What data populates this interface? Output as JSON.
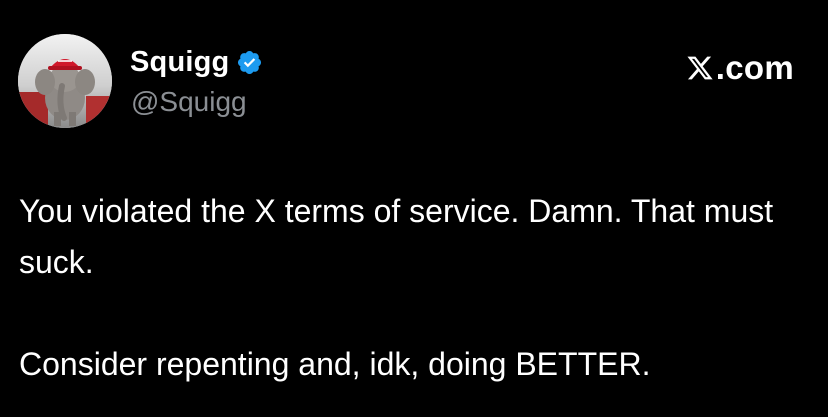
{
  "post": {
    "author": {
      "display_name": "Squigg",
      "handle": "@Squigg",
      "verified": true,
      "avatar": "elephant-in-red-cap"
    },
    "brand": {
      "text": ".com",
      "logo": "x-logo-icon"
    },
    "paragraphs": [
      "You violated the X terms of service. Damn. That must suck.",
      "Consider repenting and, idk, doing BETTER."
    ]
  },
  "colors": {
    "background": "#000000",
    "text": "#ffffff",
    "handle": "#8b8f94",
    "verified_badge": "#1d9bf0"
  }
}
